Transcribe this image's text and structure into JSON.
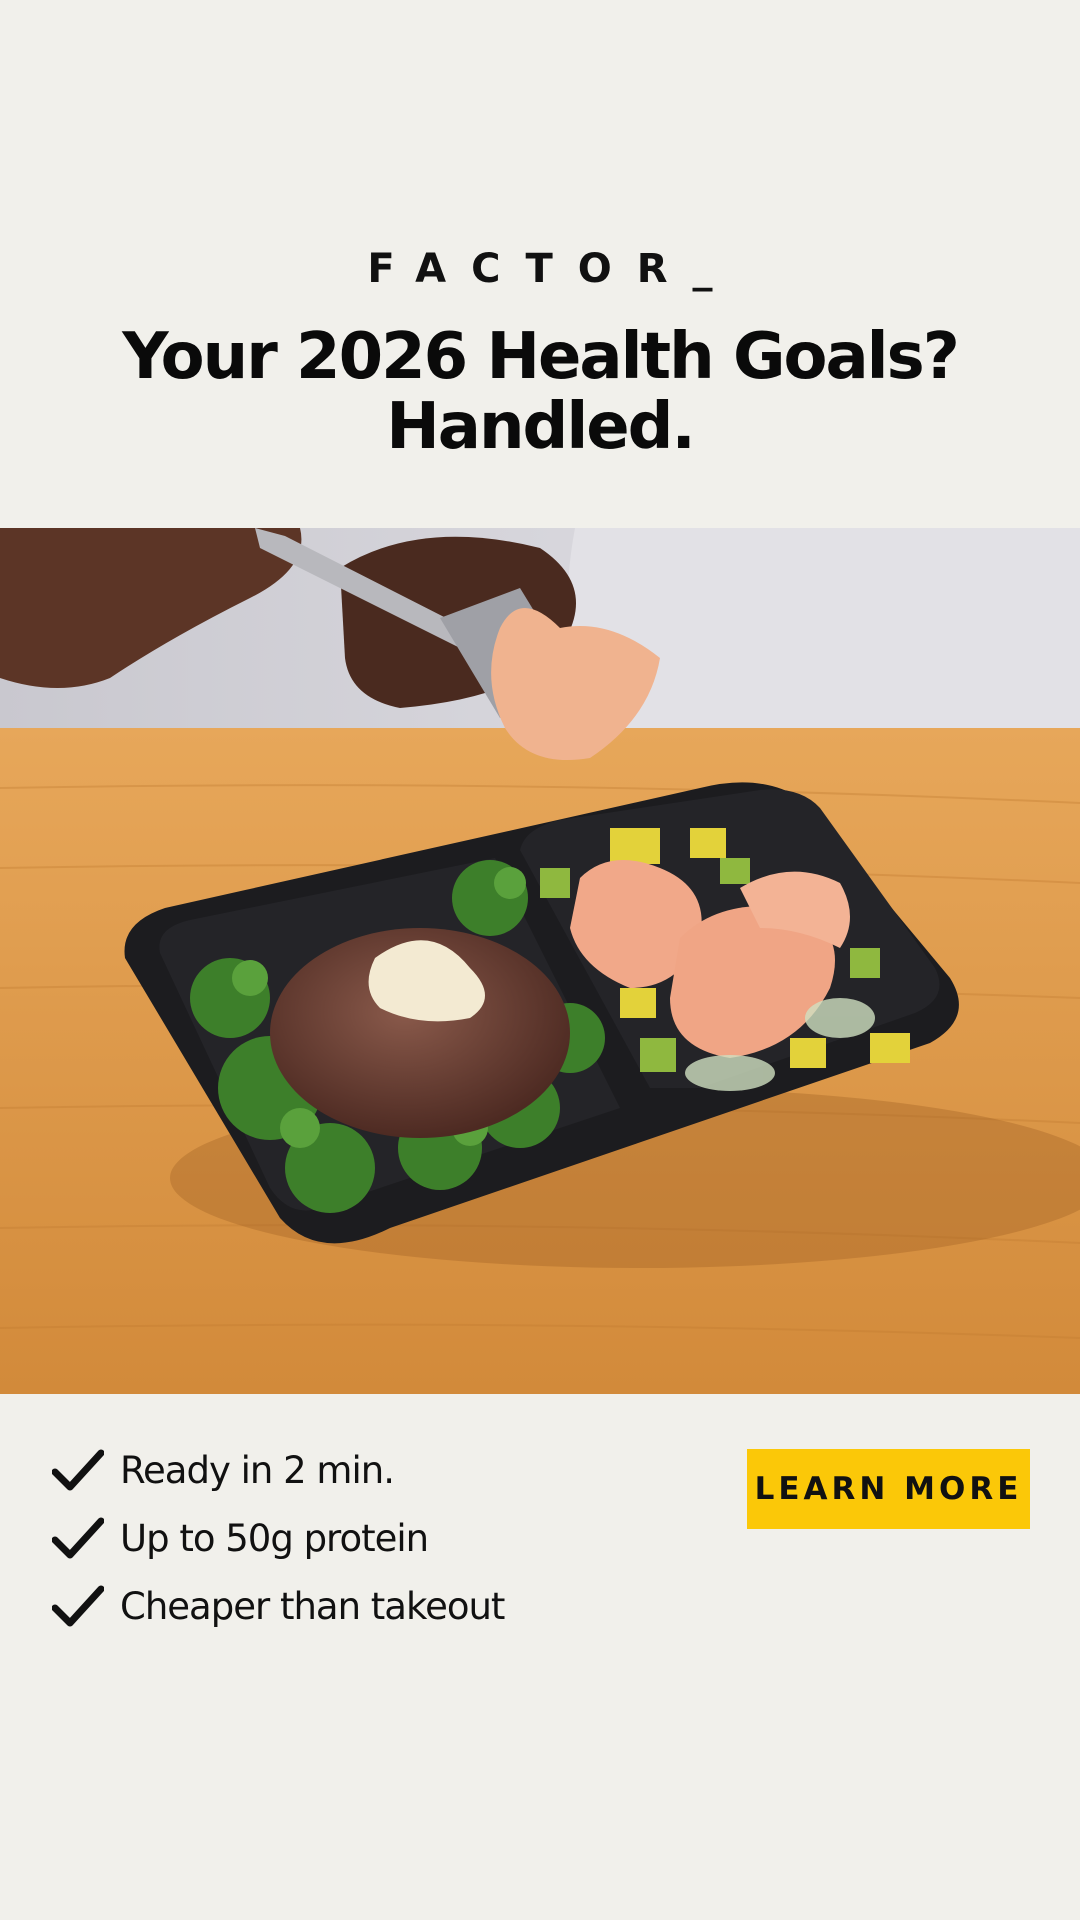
{
  "brand": {
    "logo_text": "FACTOR_"
  },
  "hero": {
    "headline_line1": "Your 2026 Health Goals?",
    "headline_line2": "Handled.",
    "photo": "meal tray with steak, broccolini, shrimp and vegetables on wooden table"
  },
  "features": [
    {
      "icon": "checkmark-icon",
      "label": "Ready in 2 min."
    },
    {
      "icon": "checkmark-icon",
      "label": "Up to 50g protein"
    },
    {
      "icon": "checkmark-icon",
      "label": "Cheaper than takeout"
    }
  ],
  "cta": {
    "label": "LEARN MORE"
  },
  "colors": {
    "background": "#f1f0eb",
    "cta": "#fbc808",
    "text": "#0c0c0c",
    "table": "#d6913f"
  }
}
